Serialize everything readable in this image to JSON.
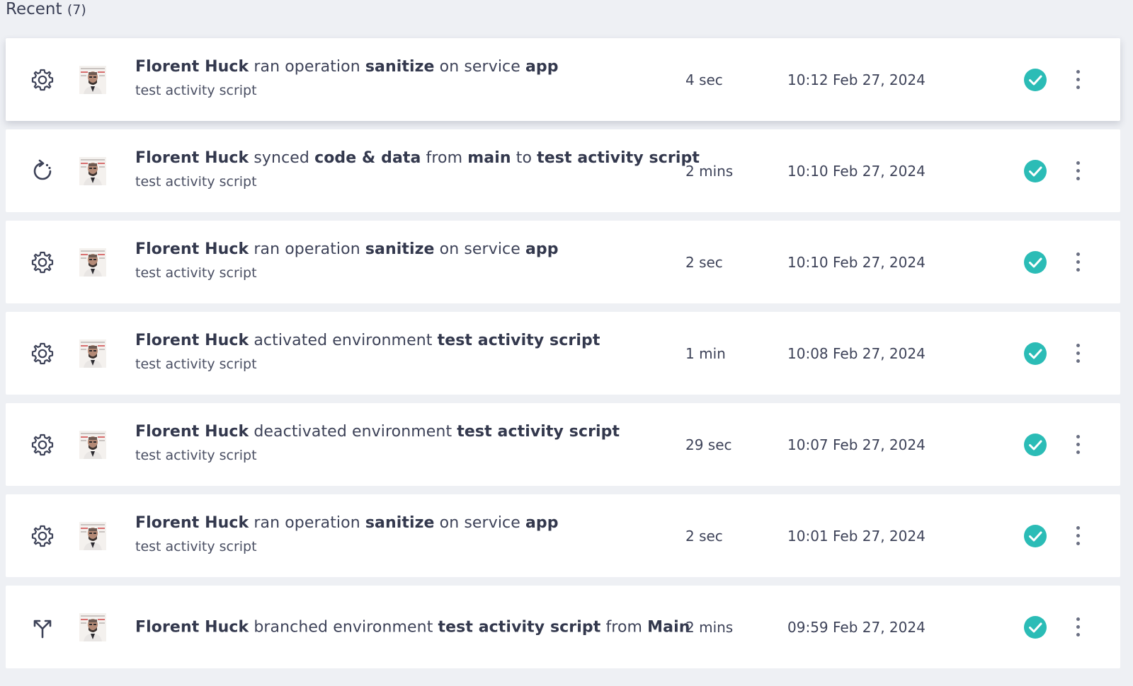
{
  "header": {
    "title": "Recent",
    "count": "(7)"
  },
  "colors": {
    "success": "#2bbcb6",
    "text": "#3d4258",
    "background": "#eef0f4"
  },
  "activities": [
    {
      "icon": "gear-icon",
      "title_parts": [
        {
          "text": "Florent Huck",
          "bold": true
        },
        {
          "text": " ran operation ",
          "bold": false
        },
        {
          "text": "sanitize",
          "bold": true
        },
        {
          "text": " on service ",
          "bold": false
        },
        {
          "text": "app",
          "bold": true
        }
      ],
      "subtitle": "test activity script",
      "duration": "4 sec",
      "timestamp": "10:12 Feb 27, 2024",
      "status": "success"
    },
    {
      "icon": "sync-icon",
      "title_parts": [
        {
          "text": "Florent Huck",
          "bold": true
        },
        {
          "text": " synced ",
          "bold": false
        },
        {
          "text": "code & data",
          "bold": true
        },
        {
          "text": " from ",
          "bold": false
        },
        {
          "text": "main",
          "bold": true
        },
        {
          "text": " to ",
          "bold": false
        },
        {
          "text": "test activity script",
          "bold": true
        }
      ],
      "subtitle": "test activity script",
      "duration": "2 mins",
      "timestamp": "10:10 Feb 27, 2024",
      "status": "success"
    },
    {
      "icon": "gear-icon",
      "title_parts": [
        {
          "text": "Florent Huck",
          "bold": true
        },
        {
          "text": " ran operation ",
          "bold": false
        },
        {
          "text": "sanitize",
          "bold": true
        },
        {
          "text": " on service ",
          "bold": false
        },
        {
          "text": "app",
          "bold": true
        }
      ],
      "subtitle": "test activity script",
      "duration": "2 sec",
      "timestamp": "10:10 Feb 27, 2024",
      "status": "success"
    },
    {
      "icon": "gear-icon",
      "title_parts": [
        {
          "text": "Florent Huck",
          "bold": true
        },
        {
          "text": " activated environment ",
          "bold": false
        },
        {
          "text": "test activity script",
          "bold": true
        }
      ],
      "subtitle": "test activity script",
      "duration": "1 min",
      "timestamp": "10:08 Feb 27, 2024",
      "status": "success"
    },
    {
      "icon": "gear-icon",
      "title_parts": [
        {
          "text": "Florent Huck",
          "bold": true
        },
        {
          "text": " deactivated environment ",
          "bold": false
        },
        {
          "text": "test activity script",
          "bold": true
        }
      ],
      "subtitle": "test activity script",
      "duration": "29 sec",
      "timestamp": "10:07 Feb 27, 2024",
      "status": "success"
    },
    {
      "icon": "gear-icon",
      "title_parts": [
        {
          "text": "Florent Huck",
          "bold": true
        },
        {
          "text": " ran operation ",
          "bold": false
        },
        {
          "text": "sanitize",
          "bold": true
        },
        {
          "text": " on service ",
          "bold": false
        },
        {
          "text": "app",
          "bold": true
        }
      ],
      "subtitle": "test activity script",
      "duration": "2 sec",
      "timestamp": "10:01 Feb 27, 2024",
      "status": "success"
    },
    {
      "icon": "branch-icon",
      "title_parts": [
        {
          "text": "Florent Huck",
          "bold": true
        },
        {
          "text": " branched environment ",
          "bold": false
        },
        {
          "text": "test activity script",
          "bold": true
        },
        {
          "text": " from ",
          "bold": false
        },
        {
          "text": "Main",
          "bold": true
        }
      ],
      "subtitle": "",
      "duration": "2 mins",
      "timestamp": "09:59 Feb 27, 2024",
      "status": "success"
    }
  ]
}
